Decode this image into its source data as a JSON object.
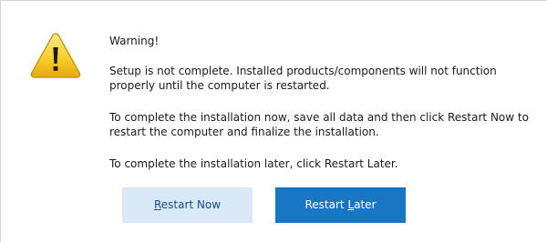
{
  "dialog": {
    "heading": "Warning!",
    "paragraphs": [
      "Setup is not complete. Installed products/components will not function properly until the computer is restarted.",
      "To complete the installation now, save all data and then click Restart Now to restart the computer and finalize the installation.",
      "To complete the installation later, click Restart Later."
    ],
    "icon": "warning-icon"
  },
  "buttons": {
    "restart_now": {
      "mnemonic": "R",
      "rest": "estart Now"
    },
    "restart_later": {
      "prefix": "Restart ",
      "mnemonic": "L",
      "rest": "ater"
    }
  },
  "colors": {
    "restart_now_bg": "#d9e9f7",
    "restart_later_bg": "#1976c5",
    "warning_yellow": "#f5c518"
  }
}
